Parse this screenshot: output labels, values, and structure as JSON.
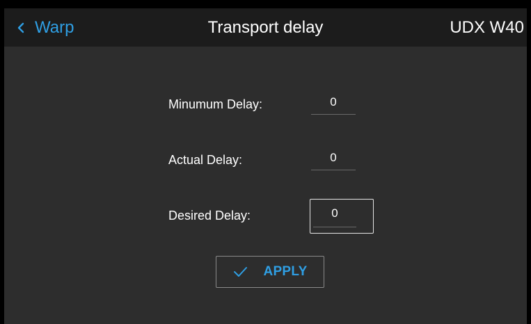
{
  "header": {
    "back_label": "Warp",
    "title": "Transport delay",
    "device_name": "UDX W40"
  },
  "fields": {
    "minimum_delay": {
      "label": "Minumum Delay:",
      "value": "0"
    },
    "actual_delay": {
      "label": "Actual Delay:",
      "value": "0"
    },
    "desired_delay": {
      "label": "Desired Delay:",
      "value": "0"
    }
  },
  "apply_button": {
    "label": "APPLY"
  },
  "icons": {
    "back": "chevron-left-icon",
    "apply": "checkmark-icon"
  },
  "colors": {
    "accent": "#2f9fe4",
    "background": "#2d2d2d",
    "header_background": "#1c1c1c",
    "text": "#ffffff"
  }
}
